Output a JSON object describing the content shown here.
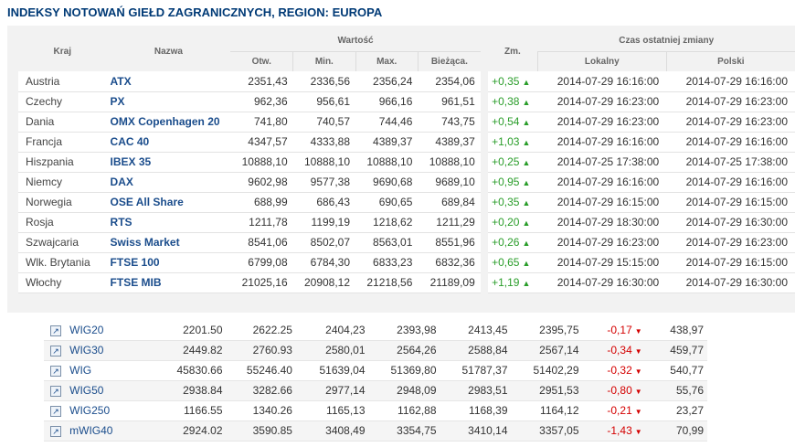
{
  "title": "INDEKSY NOTOWAŃ GIEŁD ZAGRANICZNYCH, REGION: EUROPA",
  "headers": {
    "kraj": "Kraj",
    "nazwa": "Nazwa",
    "wartosc": "Wartość",
    "otw": "Otw.",
    "min": "Min.",
    "max": "Max.",
    "biezaca": "Bieżąca.",
    "zm": "Zm.",
    "czas": "Czas ostatniej zmiany",
    "lokalny": "Lokalny",
    "polski": "Polski"
  },
  "colors": {
    "title": "#003a76",
    "link": "#1b4d8c",
    "positive": "#2a9d2a",
    "negative": "#d40000"
  },
  "rows": [
    {
      "kraj": "Austria",
      "nazwa": "ATX",
      "otw": "2351,43",
      "min": "2336,56",
      "max": "2356,24",
      "biez": "2354,06",
      "zm": "+0,35",
      "lok": "2014-07-29 16:16:00",
      "pol": "2014-07-29 16:16:00"
    },
    {
      "kraj": "Czechy",
      "nazwa": "PX",
      "otw": "962,36",
      "min": "956,61",
      "max": "966,16",
      "biez": "961,51",
      "zm": "+0,38",
      "lok": "2014-07-29 16:23:00",
      "pol": "2014-07-29 16:23:00"
    },
    {
      "kraj": "Dania",
      "nazwa": "OMX Copenhagen 20",
      "otw": "741,80",
      "min": "740,57",
      "max": "744,46",
      "biez": "743,75",
      "zm": "+0,54",
      "lok": "2014-07-29 16:23:00",
      "pol": "2014-07-29 16:23:00"
    },
    {
      "kraj": "Francja",
      "nazwa": "CAC 40",
      "otw": "4347,57",
      "min": "4333,88",
      "max": "4389,37",
      "biez": "4389,37",
      "zm": "+1,03",
      "lok": "2014-07-29 16:16:00",
      "pol": "2014-07-29 16:16:00"
    },
    {
      "kraj": "Hiszpania",
      "nazwa": "IBEX 35",
      "otw": "10888,10",
      "min": "10888,10",
      "max": "10888,10",
      "biez": "10888,10",
      "zm": "+0,25",
      "lok": "2014-07-25 17:38:00",
      "pol": "2014-07-25 17:38:00"
    },
    {
      "kraj": "Niemcy",
      "nazwa": "DAX",
      "otw": "9602,98",
      "min": "9577,38",
      "max": "9690,68",
      "biez": "9689,10",
      "zm": "+0,95",
      "lok": "2014-07-29 16:16:00",
      "pol": "2014-07-29 16:16:00"
    },
    {
      "kraj": "Norwegia",
      "nazwa": "OSE All Share",
      "otw": "688,99",
      "min": "686,43",
      "max": "690,65",
      "biez": "689,84",
      "zm": "+0,35",
      "lok": "2014-07-29 16:15:00",
      "pol": "2014-07-29 16:15:00"
    },
    {
      "kraj": "Rosja",
      "nazwa": "RTS",
      "otw": "1211,78",
      "min": "1199,19",
      "max": "1218,62",
      "biez": "1211,29",
      "zm": "+0,20",
      "lok": "2014-07-29 18:30:00",
      "pol": "2014-07-29 16:30:00"
    },
    {
      "kraj": "Szwajcaria",
      "nazwa": "Swiss Market",
      "otw": "8541,06",
      "min": "8502,07",
      "max": "8563,01",
      "biez": "8551,96",
      "zm": "+0,26",
      "lok": "2014-07-29 16:23:00",
      "pol": "2014-07-29 16:23:00"
    },
    {
      "kraj": "Wlk. Brytania",
      "nazwa": "FTSE 100",
      "otw": "6799,08",
      "min": "6784,30",
      "max": "6833,23",
      "biez": "6832,36",
      "zm": "+0,65",
      "lok": "2014-07-29 15:15:00",
      "pol": "2014-07-29 16:15:00"
    },
    {
      "kraj": "Włochy",
      "nazwa": "FTSE MIB",
      "otw": "21025,16",
      "min": "20908,12",
      "max": "21218,56",
      "biez": "21189,09",
      "zm": "+1,19",
      "lok": "2014-07-29 16:30:00",
      "pol": "2014-07-29 16:30:00"
    }
  ],
  "wig": [
    {
      "nazwa": "WIG20",
      "c1": "2201.50",
      "c2": "2622.25",
      "c3": "2404,23",
      "c4": "2393,98",
      "c5": "2413,45",
      "c6": "2395,75",
      "zm": "-0,17",
      "c8": "438,97"
    },
    {
      "nazwa": "WIG30",
      "c1": "2449.82",
      "c2": "2760.93",
      "c3": "2580,01",
      "c4": "2564,26",
      "c5": "2588,84",
      "c6": "2567,14",
      "zm": "-0,34",
      "c8": "459,77"
    },
    {
      "nazwa": "WIG",
      "c1": "45830.66",
      "c2": "55246.40",
      "c3": "51639,04",
      "c4": "51369,80",
      "c5": "51787,37",
      "c6": "51402,29",
      "zm": "-0,32",
      "c8": "540,77"
    },
    {
      "nazwa": "WIG50",
      "c1": "2938.84",
      "c2": "3282.66",
      "c3": "2977,14",
      "c4": "2948,09",
      "c5": "2983,51",
      "c6": "2951,53",
      "zm": "-0,80",
      "c8": "55,76"
    },
    {
      "nazwa": "WIG250",
      "c1": "1166.55",
      "c2": "1340.26",
      "c3": "1165,13",
      "c4": "1162,88",
      "c5": "1168,39",
      "c6": "1164,12",
      "zm": "-0,21",
      "c8": "23,27"
    },
    {
      "nazwa": "mWIG40",
      "c1": "2924.02",
      "c2": "3590.85",
      "c3": "3408,49",
      "c4": "3354,75",
      "c5": "3410,14",
      "c6": "3357,05",
      "zm": "-1,43",
      "c8": "70,99"
    }
  ]
}
